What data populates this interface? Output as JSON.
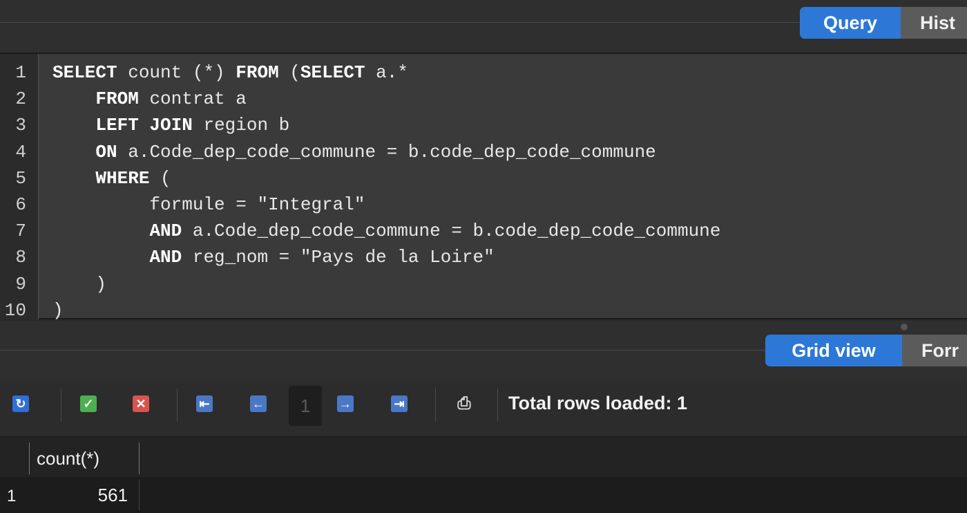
{
  "tabs": {
    "query": "Query",
    "history": "Hist"
  },
  "editor": {
    "lines": [
      {
        "num": "1",
        "segments": [
          {
            "t": "SELECT",
            "kw": true
          },
          {
            "t": " count (*) "
          },
          {
            "t": "FROM",
            "kw": true
          },
          {
            "t": " ("
          },
          {
            "t": "SELECT",
            "kw": true
          },
          {
            "t": " a.*"
          }
        ]
      },
      {
        "num": "2",
        "segments": [
          {
            "t": "    "
          },
          {
            "t": "FROM",
            "kw": true
          },
          {
            "t": " contrat a"
          }
        ]
      },
      {
        "num": "3",
        "segments": [
          {
            "t": "    "
          },
          {
            "t": "LEFT JOIN",
            "kw": true
          },
          {
            "t": " region b"
          }
        ]
      },
      {
        "num": "4",
        "segments": [
          {
            "t": "    "
          },
          {
            "t": "ON",
            "kw": true
          },
          {
            "t": " a.Code_dep_code_commune = b.code_dep_code_commune"
          }
        ]
      },
      {
        "num": "5",
        "segments": [
          {
            "t": "    "
          },
          {
            "t": "WHERE",
            "kw": true
          },
          {
            "t": " ("
          }
        ]
      },
      {
        "num": "6",
        "segments": [
          {
            "t": "         formule = \"Integral\""
          }
        ]
      },
      {
        "num": "7",
        "segments": [
          {
            "t": "         "
          },
          {
            "t": "AND",
            "kw": true
          },
          {
            "t": " a.Code_dep_code_commune = b.code_dep_code_commune"
          }
        ]
      },
      {
        "num": "8",
        "segments": [
          {
            "t": "         "
          },
          {
            "t": "AND",
            "kw": true
          },
          {
            "t": " reg_nom = \"Pays de la Loire\""
          }
        ]
      },
      {
        "num": "9",
        "segments": [
          {
            "t": "    )"
          }
        ]
      },
      {
        "num": "10",
        "segments": [
          {
            "t": ")"
          }
        ]
      }
    ]
  },
  "results_tabs": {
    "grid": "Grid view",
    "form": "Forr"
  },
  "toolbar": {
    "page": "1",
    "total_rows": "Total rows loaded: 1",
    "colors": {
      "refresh": "#2f6fd6",
      "apply": "#4caf50",
      "discard": "#d9534f",
      "nav": "#4a78c4"
    }
  },
  "grid": {
    "columns": [
      "count(*)"
    ],
    "rows": [
      {
        "num": "1",
        "cells": [
          "561"
        ]
      }
    ]
  }
}
